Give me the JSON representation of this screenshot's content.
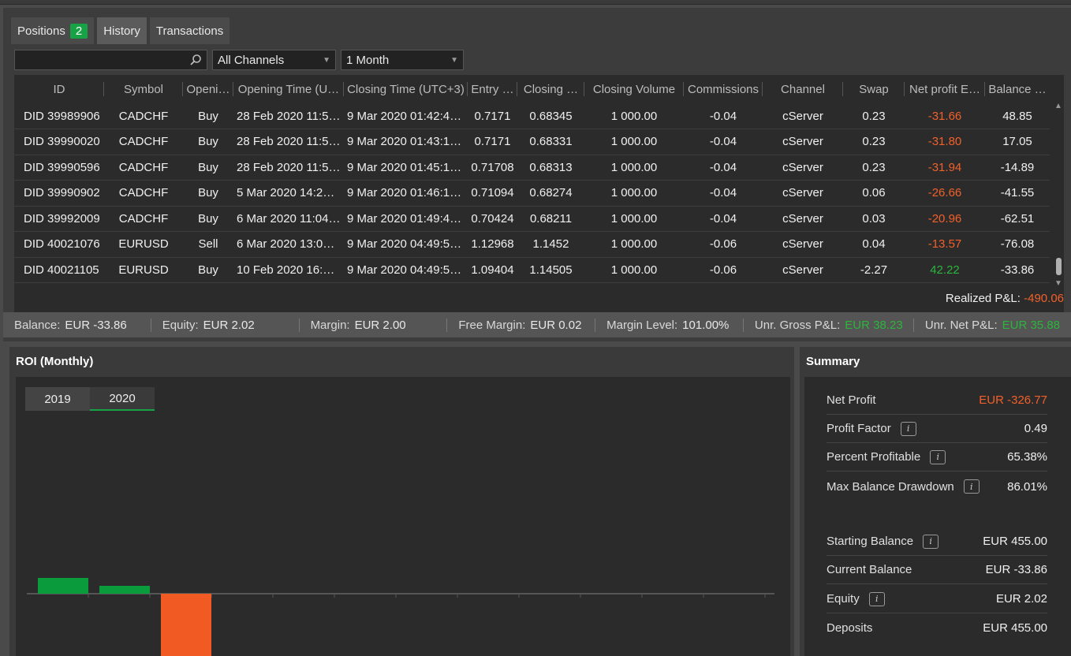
{
  "tabs": [
    {
      "label": "Positions",
      "badge": "2"
    },
    {
      "label": "History"
    },
    {
      "label": "Transactions"
    }
  ],
  "filters": {
    "search_placeholder": "",
    "channel": "All Channels",
    "period": "1 Month"
  },
  "columns": [
    "ID",
    "Symbol",
    "Openi…",
    "Opening Time (U…",
    "Closing Time (UTC+3)",
    "Entry …",
    "Closing …",
    "Closing Volume",
    "Commissions",
    "Channel",
    "Swap",
    "Net profit E…",
    "Balance …"
  ],
  "rows": [
    [
      "DID 39989906",
      "CADCHF",
      "Buy",
      "28 Feb 2020 11:58…",
      "9 Mar 2020 01:42:49.…",
      "0.7171",
      "0.68345",
      "1 000.00",
      "-0.04",
      "cServer",
      "0.23",
      "-31.66",
      "48.85"
    ],
    [
      "DID 39990020",
      "CADCHF",
      "Buy",
      "28 Feb 2020 11:58…",
      "9 Mar 2020 01:43:12.…",
      "0.7171",
      "0.68331",
      "1 000.00",
      "-0.04",
      "cServer",
      "0.23",
      "-31.80",
      "17.05"
    ],
    [
      "DID 39990596",
      "CADCHF",
      "Buy",
      "28 Feb 2020 11:58…",
      "9 Mar 2020 01:45:18.…",
      "0.71708",
      "0.68313",
      "1 000.00",
      "-0.04",
      "cServer",
      "0.23",
      "-31.94",
      "-14.89"
    ],
    [
      "DID 39990902",
      "CADCHF",
      "Buy",
      "5 Mar 2020 14:21:…",
      "9 Mar 2020 01:46:10.…",
      "0.71094",
      "0.68274",
      "1 000.00",
      "-0.04",
      "cServer",
      "0.06",
      "-26.66",
      "-41.55"
    ],
    [
      "DID 39992009",
      "CADCHF",
      "Buy",
      "6 Mar 2020 11:04:…",
      "9 Mar 2020 01:49:43.…",
      "0.70424",
      "0.68211",
      "1 000.00",
      "-0.04",
      "cServer",
      "0.03",
      "-20.96",
      "-62.51"
    ],
    [
      "DID 40021076",
      "EURUSD",
      "Sell",
      "6 Mar 2020 13:03:…",
      "9 Mar 2020 04:49:51.…",
      "1.12968",
      "1.1452",
      "1 000.00",
      "-0.06",
      "cServer",
      "0.04",
      "-13.57",
      "-76.08"
    ],
    [
      "DID 40021105",
      "EURUSD",
      "Buy",
      "10 Feb 2020 16:5…",
      "9 Mar 2020 04:49:51.…",
      "1.09404",
      "1.14505",
      "1 000.00",
      "-0.06",
      "cServer",
      "-2.27",
      "42.22",
      "-33.86"
    ]
  ],
  "realized": {
    "label": "Realized P&L:",
    "value": "-490.06"
  },
  "status": [
    {
      "label": "Balance:",
      "value": "EUR -33.86"
    },
    {
      "label": "Equity:",
      "value": "EUR 2.02"
    },
    {
      "label": "Margin:",
      "value": "EUR 2.00"
    },
    {
      "label": "Free Margin:",
      "value": "EUR 0.02"
    },
    {
      "label": "Margin Level:",
      "value": "101.00%"
    },
    {
      "label": "Unr. Gross P&L:",
      "value": "EUR 38.23"
    },
    {
      "label": "Unr. Net P&L:",
      "value": "EUR 35.88"
    }
  ],
  "roi": {
    "title": "ROI (Monthly)",
    "years": [
      "2019",
      "2020"
    ],
    "active_year": "2020"
  },
  "chart_data": {
    "type": "bar",
    "values": [
      4,
      2,
      -17,
      0,
      0,
      0,
      0,
      0,
      0,
      0,
      0,
      0
    ]
  },
  "summary": {
    "title": "Summary",
    "rows": [
      {
        "label": "Net Profit",
        "value": "EUR -326.77",
        "info": false
      },
      {
        "label": "Profit Factor",
        "value": "0.49",
        "info": true
      },
      {
        "label": "Percent Profitable",
        "value": "65.38%",
        "info": true
      },
      {
        "label": "Max Balance Drawdown",
        "value": "86.01%",
        "info": true
      },
      {
        "label": "Starting Balance",
        "value": "EUR 455.00",
        "info": true
      },
      {
        "label": "Current Balance",
        "value": "EUR -33.86",
        "info": false
      },
      {
        "label": "Equity",
        "value": "EUR 2.02",
        "info": true
      },
      {
        "label": "Deposits",
        "value": "EUR 455.00",
        "info": false
      }
    ]
  },
  "colors": {
    "positive": "#2cb53c",
    "negative": "#f2602a",
    "accent": "#17a345"
  }
}
